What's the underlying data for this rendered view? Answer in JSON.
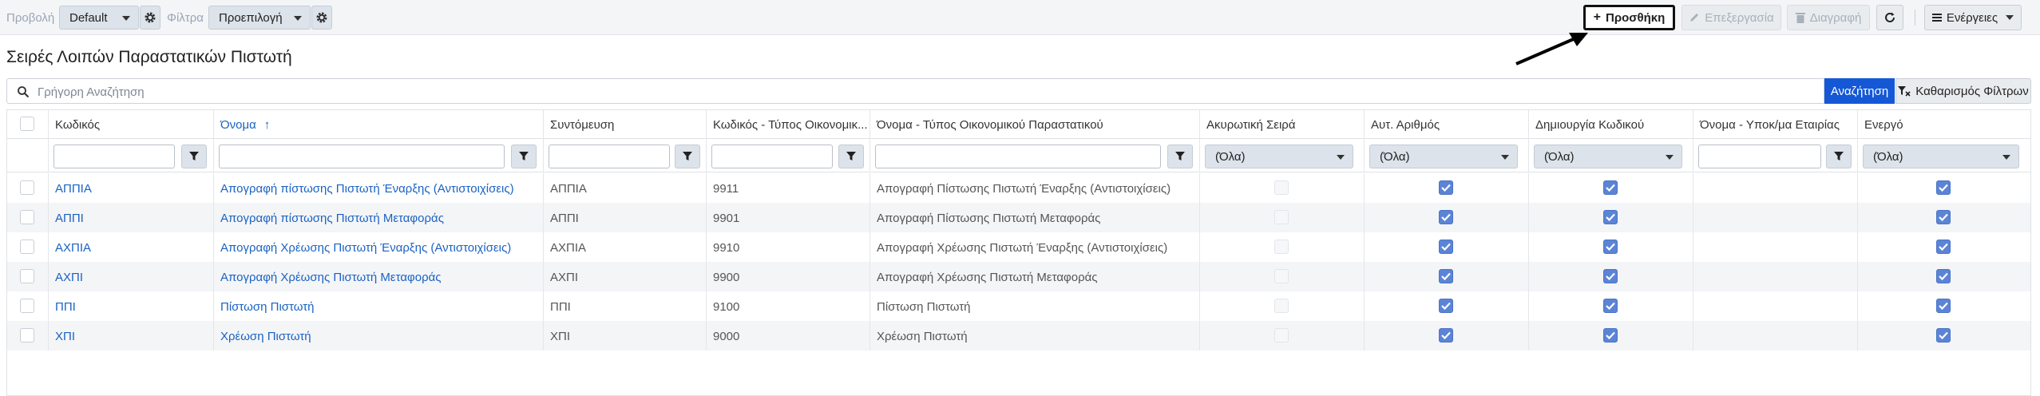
{
  "toolbar": {
    "view_label": "Προβολή",
    "view_value": "Default",
    "filter_label": "Φίλτρα",
    "filter_value": "Προεπιλογή",
    "add_label": "Προσθήκη",
    "edit_label": "Επεξεργασία",
    "delete_label": "Διαγραφή",
    "actions_label": "Ενέργειες"
  },
  "page": {
    "title": "Σειρές Λοιπών Παραστατικών Πιστωτή"
  },
  "search": {
    "placeholder": "Γρήγορη Αναζήτηση",
    "search_label": "Αναζήτηση",
    "clear_label": "Καθαρισμός Φίλτρων"
  },
  "grid": {
    "columns": [
      "Κωδικός",
      "Όνομα",
      "Συντόμευση",
      "Κωδικός - Τύπος Οικονομικ...",
      "Όνομα - Τύπος Οικονομικού Παραστατικού",
      "Ακυρωτική Σειρά",
      "Αυτ. Αριθμός",
      "Δημιουργία Κωδικού",
      "Όνομα - Υποκ/μα Εταιρίας",
      "Ενεργό"
    ],
    "sorted_column": "Όνομα",
    "filter_all": "(Όλα)",
    "rows": [
      {
        "code": "ΑΠΠΙΑ",
        "name": "Απογραφή πίστωσης Πιστωτή Έναρξης (Αντιστοιχίσεις)",
        "short": "ΑΠΠΙΑ",
        "type_code": "9911",
        "type_name": "Απογραφή Πίστωσης Πιστωτή Έναρξης (Αντιστοιχίσεις)",
        "cancel": false,
        "auto": true,
        "gen": true,
        "active": true
      },
      {
        "code": "ΑΠΠΙ",
        "name": "Απογραφή πίστωσης Πιστωτή Μεταφοράς",
        "short": "ΑΠΠΙ",
        "type_code": "9901",
        "type_name": "Απογραφή Πίστωσης Πιστωτή Μεταφοράς",
        "cancel": false,
        "auto": true,
        "gen": true,
        "active": true
      },
      {
        "code": "ΑΧΠΙΑ",
        "name": "Απογραφή Χρέωσης Πιστωτή Έναρξης (Αντιστοιχίσεις)",
        "short": "ΑΧΠΙΑ",
        "type_code": "9910",
        "type_name": "Απογραφή Χρέωσης Πιστωτή Έναρξης (Αντιστοιχίσεις)",
        "cancel": false,
        "auto": true,
        "gen": true,
        "active": true
      },
      {
        "code": "ΑΧΠΙ",
        "name": "Απογραφή Χρέωσης Πιστωτή Μεταφοράς",
        "short": "ΑΧΠΙ",
        "type_code": "9900",
        "type_name": "Απογραφή Χρέωσης Πιστωτή Μεταφοράς",
        "cancel": false,
        "auto": true,
        "gen": true,
        "active": true
      },
      {
        "code": "ΠΠΙ",
        "name": "Πίστωση Πιστωτή",
        "short": "ΠΠΙ",
        "type_code": "9100",
        "type_name": "Πίστωση Πιστωτή",
        "cancel": false,
        "auto": true,
        "gen": true,
        "active": true
      },
      {
        "code": "ΧΠΙ",
        "name": "Χρέωση Πιστωτή",
        "short": "ΧΠΙ",
        "type_code": "9000",
        "type_name": "Χρέωση Πιστωτή",
        "cancel": false,
        "auto": true,
        "gen": true,
        "active": true
      }
    ]
  },
  "colors": {
    "accent": "#1558d6",
    "link": "#1a62c4",
    "checked": "#5b84d6"
  }
}
